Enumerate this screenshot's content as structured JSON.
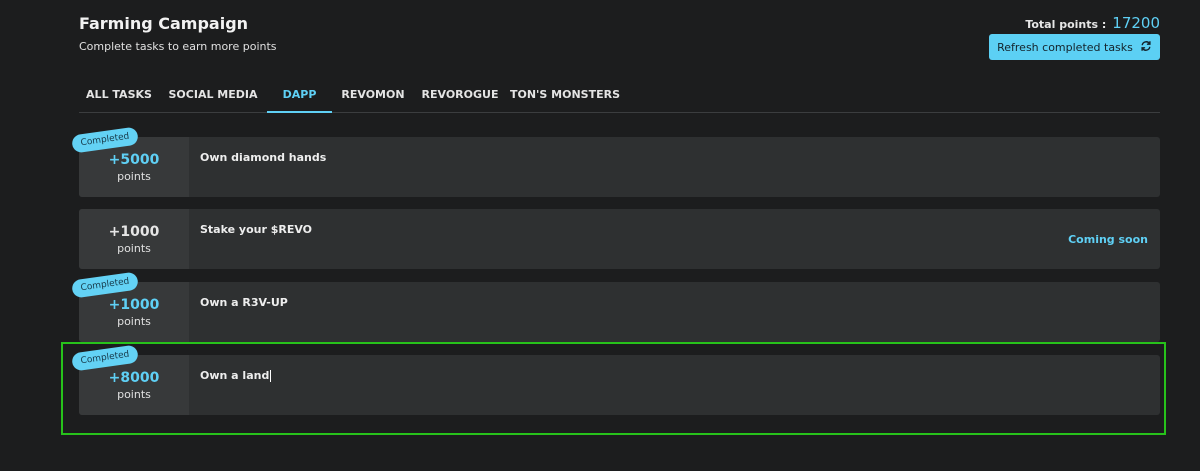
{
  "header": {
    "title": "Farming Campaign",
    "subtitle": "Complete tasks to earn more points",
    "total_label": "Total points :",
    "total_value": "17200",
    "refresh_label": "Refresh completed tasks"
  },
  "tabs": [
    {
      "label": "ALL TASKS",
      "active": false
    },
    {
      "label": "SOCIAL MEDIA",
      "active": false
    },
    {
      "label": "DAPP",
      "active": true
    },
    {
      "label": "REVOMON",
      "active": false
    },
    {
      "label": "REVOROGUE",
      "active": false
    },
    {
      "label": "TON'S MONSTERS",
      "active": false
    }
  ],
  "tasks": [
    {
      "points": "+5000",
      "unit": "points",
      "title": "Own diamond hands",
      "badge": "Completed"
    },
    {
      "points": "+1000",
      "unit": "points",
      "title": "Stake your $REVO",
      "status": "Coming soon"
    },
    {
      "points": "+1000",
      "unit": "points",
      "title": "Own a R3V-UP",
      "badge": "Completed"
    },
    {
      "points": "+8000",
      "unit": "points",
      "title": "Own a land",
      "badge": "Completed"
    }
  ],
  "colors": {
    "accent": "#5fd0f5",
    "background": "#1c1d1e",
    "card": "#2e3031",
    "highlight": "#27c21b"
  },
  "icons": {
    "refresh": "refresh-icon"
  }
}
